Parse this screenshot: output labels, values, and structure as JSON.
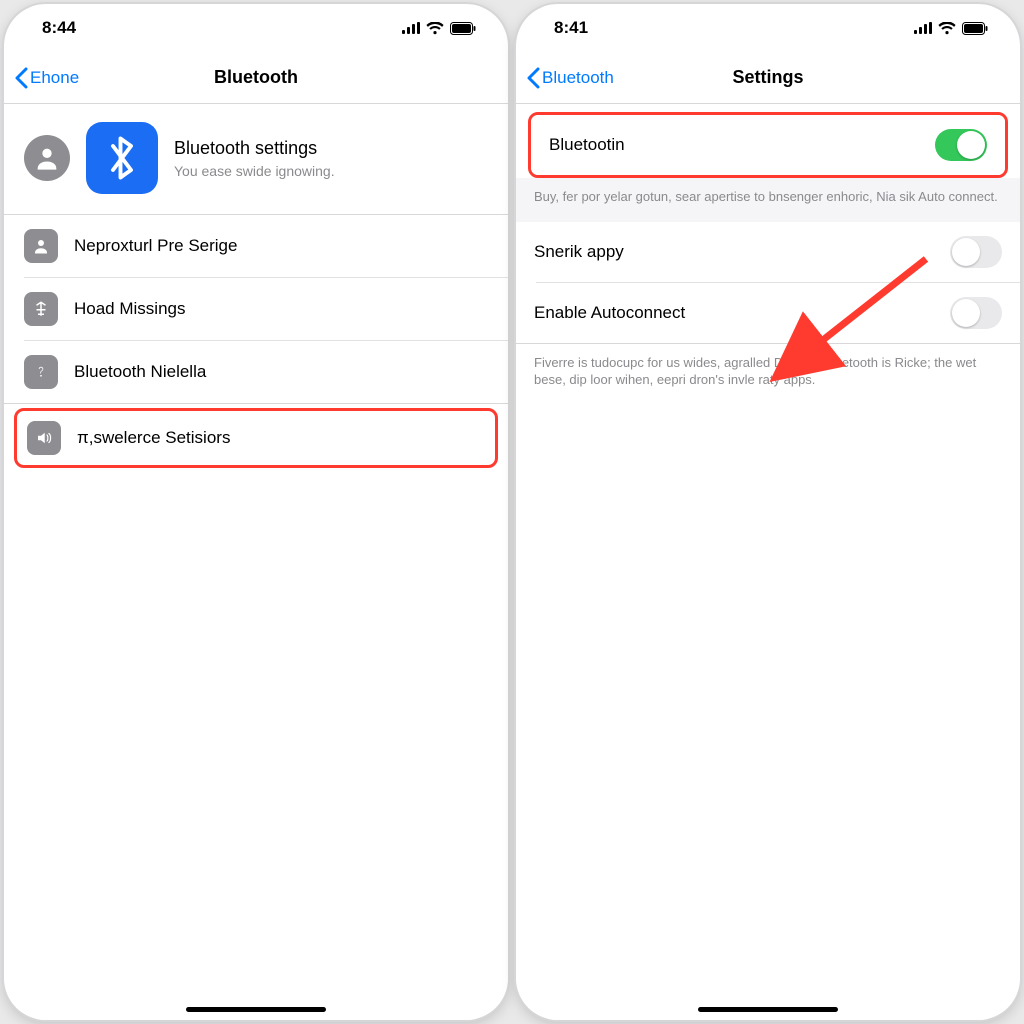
{
  "left": {
    "status_time": "8:44",
    "back_label": "Ehone",
    "title": "Bluetooth",
    "header_title": "Bluetooth settings",
    "header_sub": "You ease swide ignowing.",
    "rows": [
      {
        "label": "Neproxturl Pre Serige"
      },
      {
        "label": "Hoad Missings"
      },
      {
        "label": "Bluetooth Nielella"
      }
    ],
    "highlight_label": "π,swelerce Setisiors"
  },
  "right": {
    "status_time": "8:41",
    "back_label": "Bluetooth",
    "title": "Settings",
    "bluetooth_label": "Bluetootin",
    "bluetooth_on": true,
    "bluetooth_footnote": "Buy, fer por yelar gotun, sear apertise to bnsenger enhoric, Nia sik Auto connect.",
    "rows": [
      {
        "label": "Snerik appy",
        "on": false
      },
      {
        "label": "Enable Autoconnect",
        "on": false
      }
    ],
    "bottom_footnote": "Fiverre is tudocupc for us wides, agralled Date on Bluetooth is Ricke; the wet bese, dip loor wihen, eepri dron's invle raty apps."
  },
  "colors": {
    "accent": "#007aff",
    "highlight": "#ff3b30",
    "switch_on": "#34c759"
  }
}
